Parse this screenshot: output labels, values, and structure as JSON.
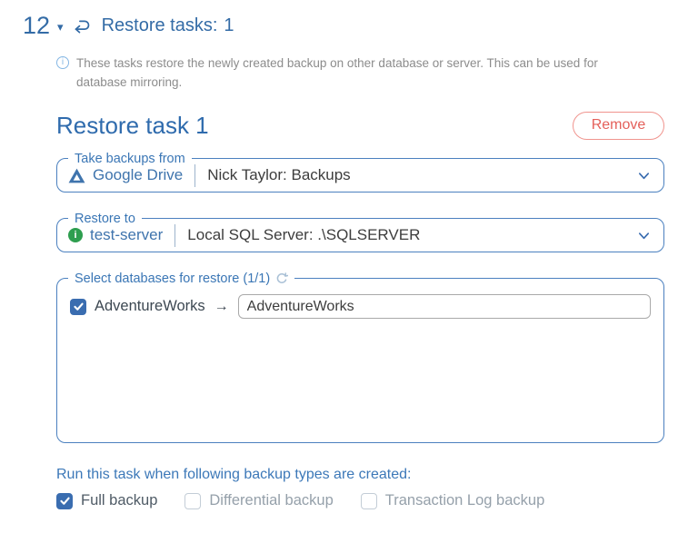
{
  "colors": {
    "primary_blue": "#336ba6",
    "legend_blue": "#3a76b5",
    "border_blue": "#4b80bf",
    "checkbox_blue": "#3a6db0",
    "danger_red": "#e4605a",
    "success_green": "#2e9e4f"
  },
  "header": {
    "step_number": "12",
    "title": "Restore tasks:",
    "count": "1"
  },
  "info": {
    "text": "These tasks restore the newly created backup on other database or server. This can be used for database mirroring."
  },
  "task": {
    "title": "Restore task 1",
    "remove_label": "Remove",
    "source": {
      "legend": "Take backups from",
      "provider": "Google Drive",
      "selected": "Nick Taylor: Backups"
    },
    "destination": {
      "legend": "Restore to",
      "server": "test-server",
      "selected": "Local SQL Server: .\\SQLSERVER"
    },
    "databases": {
      "legend": "Select databases for restore (1/1)",
      "items": [
        {
          "name": "AdventureWorks",
          "checked": true,
          "restore_as": "AdventureWorks"
        }
      ]
    }
  },
  "run_when": {
    "label": "Run this task when following backup types are created:",
    "options": [
      {
        "label": "Full backup",
        "checked": true
      },
      {
        "label": "Differential backup",
        "checked": false
      },
      {
        "label": "Transaction Log backup",
        "checked": false
      }
    ]
  },
  "icons": {
    "caret": "▾",
    "arrow_right": "→",
    "info_letter": "i"
  }
}
